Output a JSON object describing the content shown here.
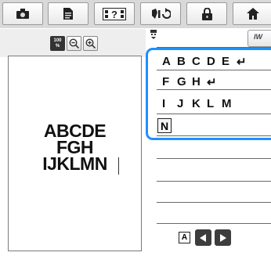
{
  "toolbar": {
    "buttons": [
      {
        "name": "camera-button",
        "icon": "camera-icon"
      },
      {
        "name": "document-button",
        "icon": "document-icon"
      },
      {
        "name": "help-button",
        "icon": "help-icon"
      },
      {
        "name": "rotate-button",
        "icon": "rotate-icon"
      },
      {
        "name": "lock-button",
        "icon": "lock-icon"
      },
      {
        "name": "home-button",
        "icon": "home-icon"
      }
    ]
  },
  "zoom": {
    "value_top": "100",
    "value_unit": "%"
  },
  "preview": {
    "lines": [
      "ABCDE",
      "FGH",
      "IJKLMN"
    ]
  },
  "editor": {
    "rows": [
      [
        "A",
        "B",
        "C",
        "D",
        "E",
        "↵"
      ],
      [
        "F",
        "G",
        "H",
        "↵"
      ],
      [
        "I",
        "J",
        "K",
        "L",
        "M"
      ]
    ],
    "cursor_char": "N",
    "highlight_color": "#1e90ff"
  },
  "controls": {
    "mode_label": "A"
  }
}
